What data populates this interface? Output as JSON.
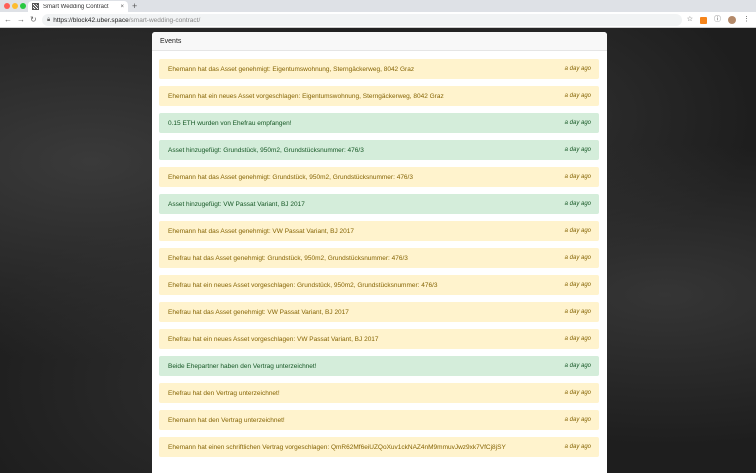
{
  "browser": {
    "tab_title": "Smart Wedding Contract",
    "tab_close": "×",
    "new_tab": "+",
    "url_host": "https://block42.uber.space",
    "url_path": "/smart-wedding-contract/"
  },
  "card": {
    "title": "Events"
  },
  "events": [
    {
      "text": "Ehemann hat das Asset genehmigt: Eigentumswohnung, Sterngäckerweg, 8042 Graz",
      "time": "a day ago",
      "kind": "warn"
    },
    {
      "text": "Ehemann hat ein neues Asset vorgeschlagen: Eigentumswohnung, Sterngäckerweg, 8042 Graz",
      "time": "a day ago",
      "kind": "warn"
    },
    {
      "text": "0.15 ETH wurden von Ehefrau empfangen!",
      "time": "a day ago",
      "kind": "ok"
    },
    {
      "text": "Asset hinzugefügt: Grundstück, 950m2, Grundstücksnummer: 476/3",
      "time": "a day ago",
      "kind": "ok"
    },
    {
      "text": "Ehemann hat das Asset genehmigt: Grundstück, 950m2, Grundstücksnummer: 476/3",
      "time": "a day ago",
      "kind": "warn"
    },
    {
      "text": "Asset hinzugefügt: VW Passat Variant, BJ 2017",
      "time": "a day ago",
      "kind": "ok"
    },
    {
      "text": "Ehemann hat das Asset genehmigt: VW Passat Variant, BJ 2017",
      "time": "a day ago",
      "kind": "warn"
    },
    {
      "text": "Ehefrau hat das Asset genehmigt: Grundstück, 950m2, Grundstücksnummer: 476/3",
      "time": "a day ago",
      "kind": "warn"
    },
    {
      "text": "Ehefrau hat ein neues Asset vorgeschlagen: Grundstück, 950m2, Grundstücksnummer: 476/3",
      "time": "a day ago",
      "kind": "warn"
    },
    {
      "text": "Ehefrau hat das Asset genehmigt: VW Passat Variant, BJ 2017",
      "time": "a day ago",
      "kind": "warn"
    },
    {
      "text": "Ehefrau hat ein neues Asset vorgeschlagen: VW Passat Variant, BJ 2017",
      "time": "a day ago",
      "kind": "warn"
    },
    {
      "text": "Beide Ehepartner haben den Vertrag unterzeichnet!",
      "time": "a day ago",
      "kind": "ok"
    },
    {
      "text": "Ehefrau hat den Vertrag unterzeichnet!",
      "time": "a day ago",
      "kind": "warn"
    },
    {
      "text": "Ehemann hat den Vertrag unterzeichnet!",
      "time": "a day ago",
      "kind": "warn"
    },
    {
      "text": "Ehemann hat einen schriftlichen Vertrag vorgeschlagen: QmR62Mf6eiUZQoXuv1ckNAZ4nM9mmuvJwz9xk7VfCj8jSY",
      "time": "a day ago",
      "kind": "warn"
    }
  ]
}
